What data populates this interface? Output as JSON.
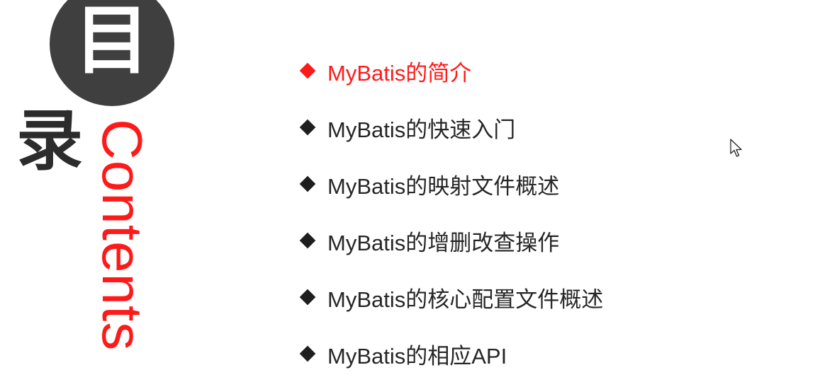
{
  "heading": {
    "char1": "目",
    "char2": "录",
    "vertical_word": "Contents"
  },
  "menu": {
    "items": [
      {
        "label": "MyBatis的简介",
        "active": true
      },
      {
        "label": "MyBatis的快速入门",
        "active": false
      },
      {
        "label": "MyBatis的映射文件概述",
        "active": false
      },
      {
        "label": "MyBatis的增删改查操作",
        "active": false
      },
      {
        "label": "MyBatis的核心配置文件概述",
        "active": false
      },
      {
        "label": "MyBatis的相应API",
        "active": false
      }
    ]
  },
  "colors": {
    "accent": "#ff1a1a",
    "dark": "#3f3f3f",
    "text": "#262626",
    "background": "#ffffff"
  },
  "icons": {
    "bullet": "diamond-bullet-icon",
    "cursor": "mouse-pointer-icon"
  }
}
